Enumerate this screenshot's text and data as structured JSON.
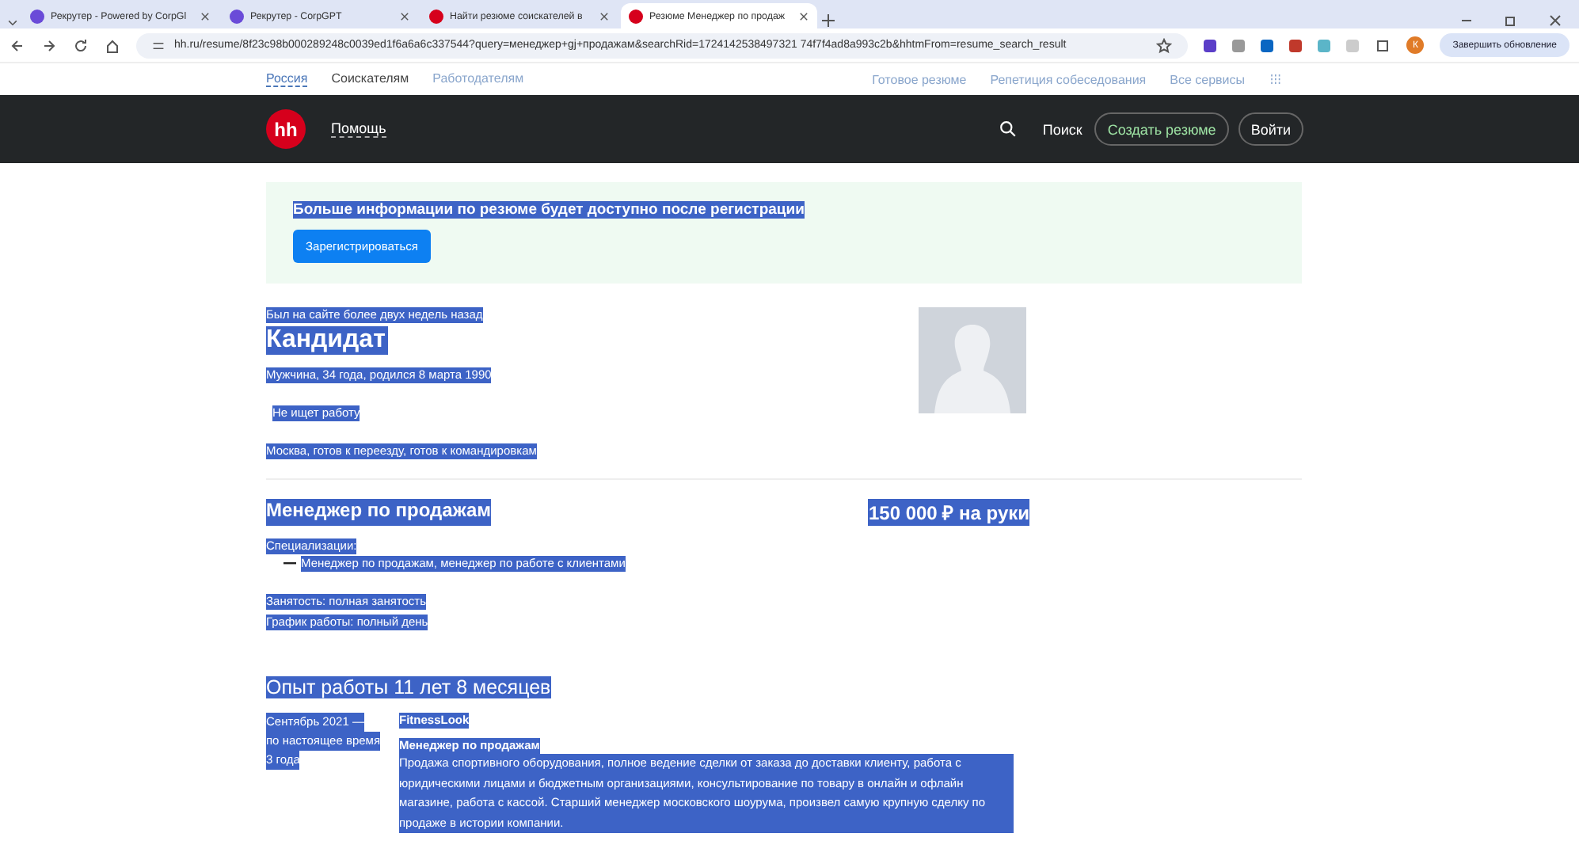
{
  "browser": {
    "tabs": [
      {
        "title": "Рекрутер - Powered by CorpGl",
        "selected": false,
        "kind": "purple"
      },
      {
        "title": "Рекрутер - CorpGPT",
        "selected": false,
        "kind": "purple"
      },
      {
        "title": "Найти резюме соискателей в",
        "selected": false,
        "kind": "red"
      },
      {
        "title": "Резюме Менеджер по продаж",
        "selected": true,
        "kind": "red"
      }
    ],
    "url": "hh.ru/resume/8f23c98b000289248c0039ed1f6a6a6c337544?query=менеджер+gj+продажам&searchRid=1724142538497321 74f7f4ad8a993c2b&hhtmFrom=resume_search_result",
    "profile_initial": "К",
    "update_button": "Завершить обновление"
  },
  "top_links": {
    "left": [
      {
        "label": "Россия",
        "selected": true
      },
      {
        "label": "Соискателям",
        "selected": false
      },
      {
        "label": "Работодателям",
        "selected": false
      }
    ],
    "right": [
      "Готовое резюме",
      "Репетиция собеседования",
      "Все сервисы"
    ]
  },
  "header": {
    "logo": "hh",
    "help": "Помощь",
    "search": "Поиск",
    "create": "Создать резюме",
    "login": "Войти"
  },
  "banner": {
    "text": "Больше информации по резюме будет доступно после регистрации",
    "button": "Зарегистрироваться"
  },
  "resume": {
    "last_seen": "Был на сайте более двух недель назад",
    "name": "Кандидат",
    "info": "Мужчина, 34 года, родился 8 марта 1990",
    "status": "Не ищет работу",
    "location": "Москва, готов к переезду, готов к командировкам",
    "position": "Менеджер по продажам",
    "salary": "150 000 ₽ на руки",
    "spec_label": "Специализации:",
    "specs": [
      "Менеджер по продажам, менеджер по работе с клиентами"
    ],
    "employment": "Занятость: полная занятость",
    "schedule": "График работы: полный день",
    "experience_title": "Опыт работы 11 лет 8 месяцев",
    "jobs": [
      {
        "period": [
          "Сентябрь 2021 —",
          "по настоящее время"
        ],
        "duration": "3 года",
        "company": "FitnessLook",
        "role": "Менеджер по продажам",
        "description": "Продажа спортивного оборудования, полное ведение сделки от заказа до доставки клиенту, работа с юридическими лицами и бюджетным организациями, консультирование по товару в онлайн и офлайн магазине, работа с кассой. Старший менеджер московского шоурума, произвел самую крупную сделку по продаже в истории компании."
      }
    ]
  }
}
